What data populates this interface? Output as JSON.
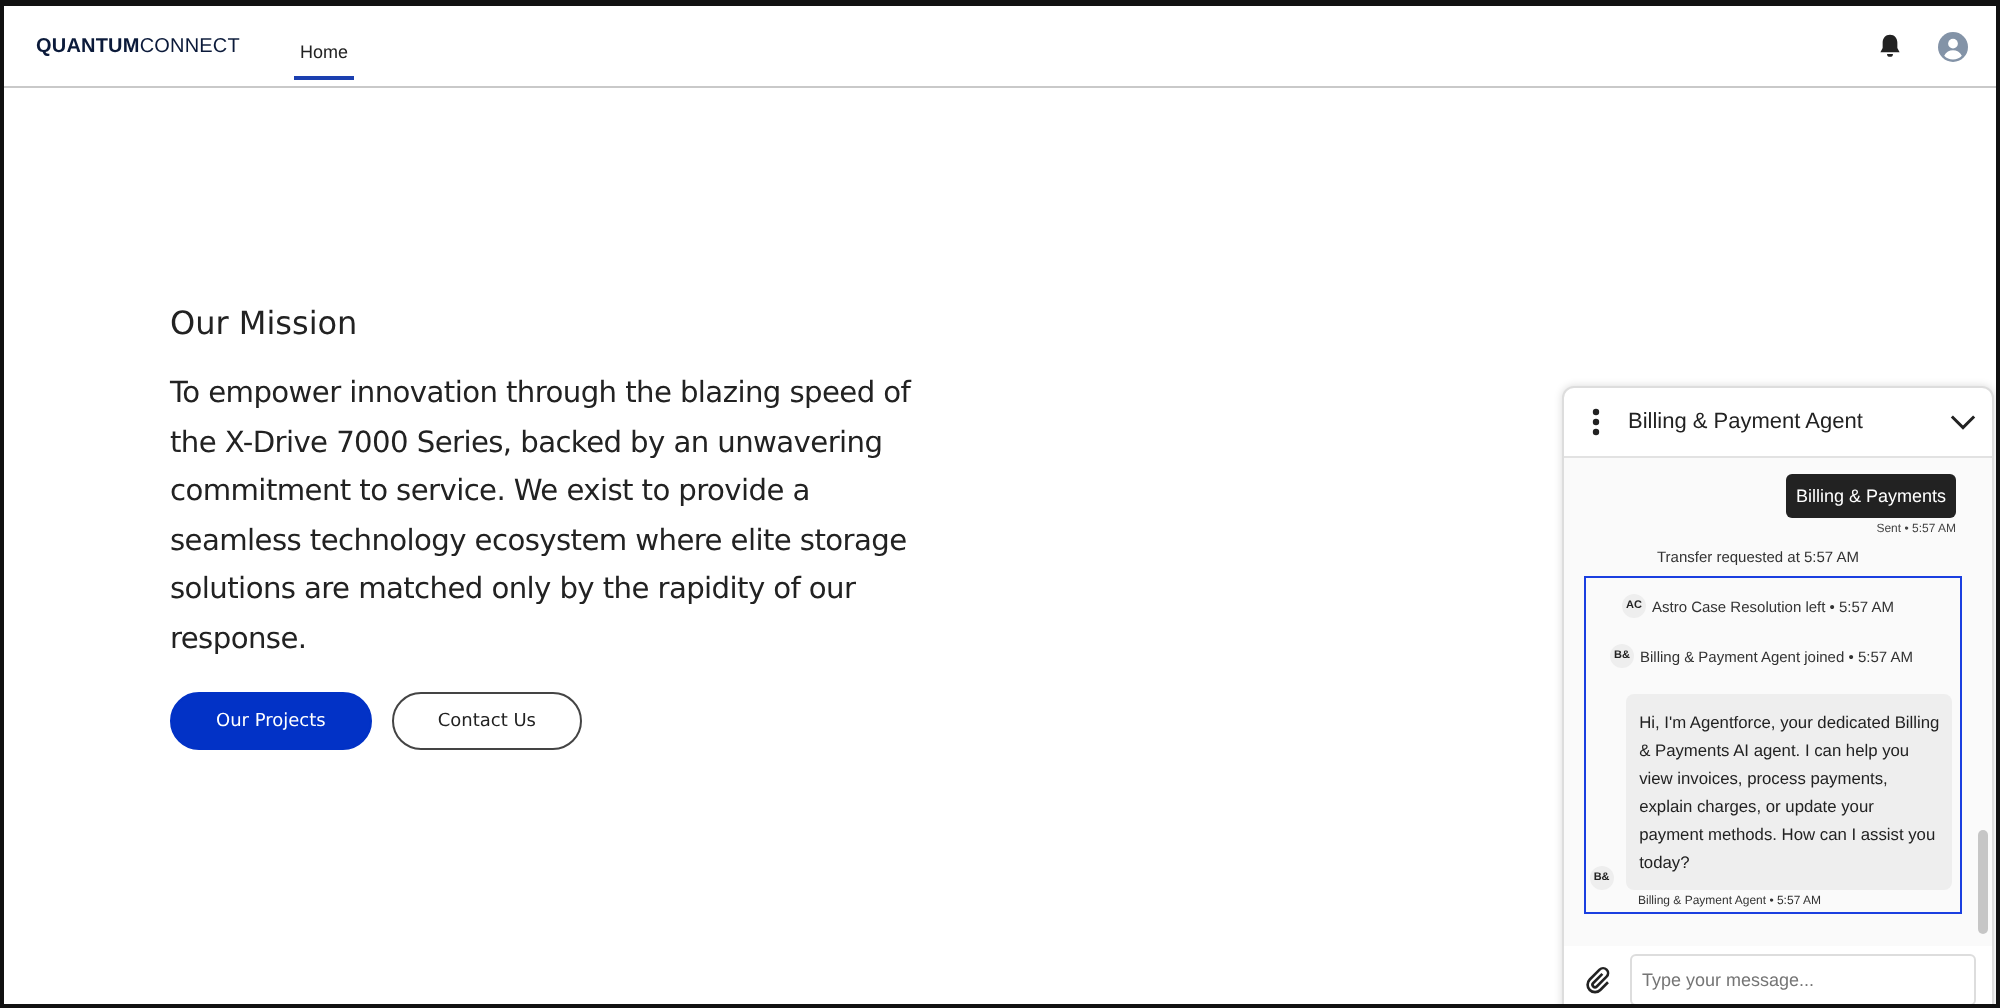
{
  "header": {
    "brand": "**QUANTUM**CONNECT",
    "nav": [
      {
        "label": "Home",
        "selected": true
      }
    ]
  },
  "hero": {
    "title": "Our Mission",
    "text": "To empower innovation through the blazing speed of the X-Drive 7000 Series, backed by an unwavering commitment to service. We exist to provide a seamless technology ecosystem where elite storage solutions are matched only by the rapidity of our response.",
    "buttons": [
      {
        "label": "Our Projects",
        "kind": "primary"
      },
      {
        "label": "Contact Us",
        "kind": "outline"
      }
    ]
  },
  "chat": {
    "title": "Billing & Payment Agent",
    "messages": [
      {
        "kind": "sent",
        "text": "Billing & Payments",
        "meta": "Sent • 5:57 AM"
      },
      {
        "kind": "notice",
        "text": "Transfer requested at 5:57 AM"
      }
    ],
    "focused": [
      {
        "kind": "event",
        "avatar": "AC",
        "text": "Astro Case Resolution left • 5:57 AM"
      },
      {
        "kind": "event",
        "avatar": "B&",
        "text": "Billing & Payment Agent joined • 5:57 AM"
      },
      {
        "kind": "agent",
        "avatar": "B&",
        "text": "Hi, I'm Agentforce, your dedicated Billing & Payments AI agent. I can help you view invoices, process payments, explain charges, or update your payment methods. How can I assist you today?",
        "meta": "Billing & Payment Agent • 5:57 AM"
      }
    ],
    "input": {
      "placeholder": "Type your message..."
    }
  }
}
